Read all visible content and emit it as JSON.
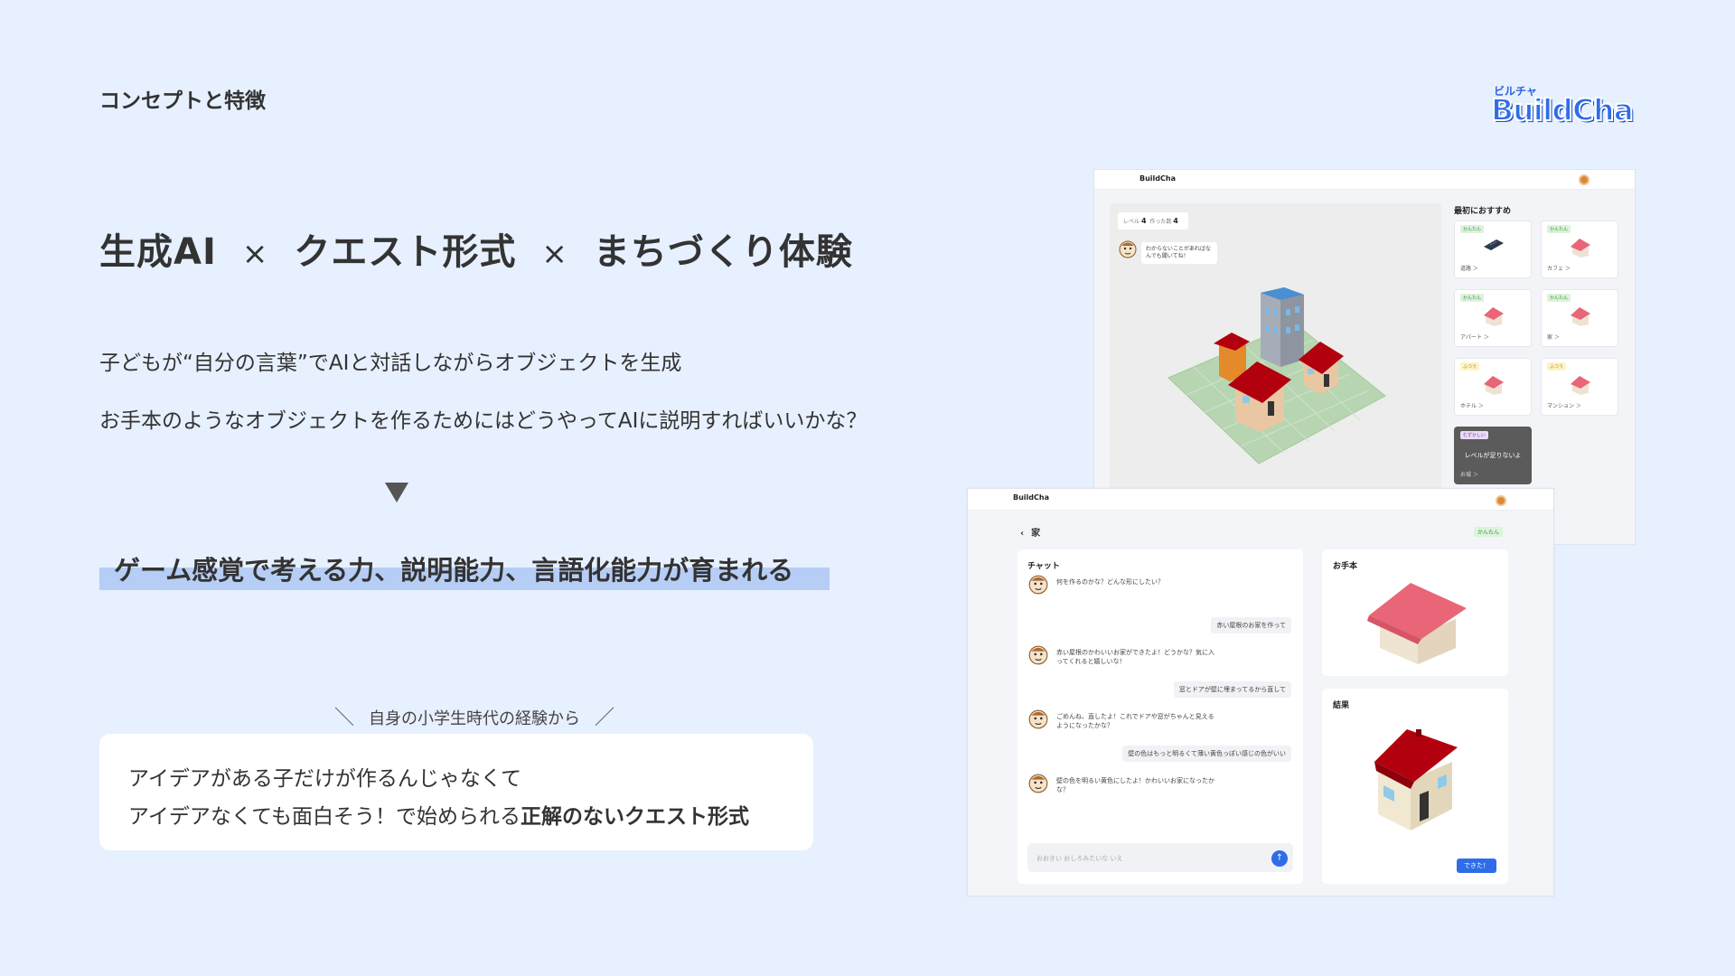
{
  "slide": {
    "section_title": "コンセプトと特徴",
    "headline": {
      "part1": "生成AI",
      "sep1": "×",
      "part2": "クエスト形式",
      "sep2": "×",
      "part3": "まちづくり体験"
    },
    "description_1": "子どもが“自分の言葉”でAIと対話しながらオブジェクトを生成",
    "description_2": "お手本のようなオブジェクトを作るためにはどうやってAIに説明すればいいかな？",
    "highlight": "ゲーム感覚で考える力、説明能力、言語化能力が育まれる",
    "sub_caption": "自身の小学生時代の経験から",
    "sub_caption_left": "＼",
    "sub_caption_right": "／",
    "quote_line_1": "アイデアがある子だけが作るんじゃなくて",
    "quote_line_2_plain": "アイデアなくても面白そう！で始められる",
    "quote_line_2_bold": "正解のないクエスト形式"
  },
  "logo": {
    "ruby": "ビルチャ",
    "name": "BuildCha"
  },
  "screen_top": {
    "brand": "BuildCha",
    "level_label": "レベル",
    "level_value": "4",
    "made_label": "作った数",
    "made_value": "4",
    "helper_message": "わからないことがあればなんでも聞いてね！",
    "recommend_title": "最初におすすめ",
    "cards": [
      {
        "badge": "かんたん",
        "label": "道路 ＞"
      },
      {
        "badge": "かんたん",
        "label": "カフェ ＞"
      },
      {
        "badge": "かんたん",
        "label": "アパート ＞"
      },
      {
        "badge": "かんたん",
        "label": "家 ＞"
      },
      {
        "badge": "ふつう",
        "label": "ホテル ＞"
      },
      {
        "badge": "ふつう",
        "label": "マンション ＞"
      },
      {
        "badge": "むずかしい",
        "label": "お城 ＞",
        "locked_text": "レベルが足りないよ"
      }
    ]
  },
  "screen_bottom": {
    "brand": "BuildCha",
    "back_icon": "‹",
    "page_title": "家",
    "difficulty": "かんたん",
    "chat_title": "チャット",
    "messages": [
      {
        "role": "ai",
        "text": "何を作るのかな？どんな形にしたい？"
      },
      {
        "role": "user",
        "text": "赤い屋根のお家を作って"
      },
      {
        "role": "ai",
        "text": "赤い屋根のかわいいお家ができたよ！どうかな？気に入ってくれると嬉しいな！"
      },
      {
        "role": "user",
        "text": "窓とドアが壁に埋まってるから直して"
      },
      {
        "role": "ai",
        "text": "ごめんね、直したよ！これでドアや窓がちゃんと見えるようになったかな？"
      },
      {
        "role": "user",
        "text": "壁の色はもっと明るくて薄い黄色っぽい感じの色がいい"
      },
      {
        "role": "ai",
        "text": "壁の色を明るい黄色にしたよ！かわいいお家になったかな？"
      }
    ],
    "input_placeholder": "おおきい おしろみたいな いえ",
    "send_icon": "↑",
    "sample_title": "お手本",
    "result_title": "結果",
    "done_label": "できた！"
  },
  "colors": {
    "background": "#e7f0fe",
    "accent_blue": "#2f6de8",
    "highlight": "#b6cdf6",
    "roof_red": "#b3000f",
    "roof_pink": "#e86677"
  }
}
